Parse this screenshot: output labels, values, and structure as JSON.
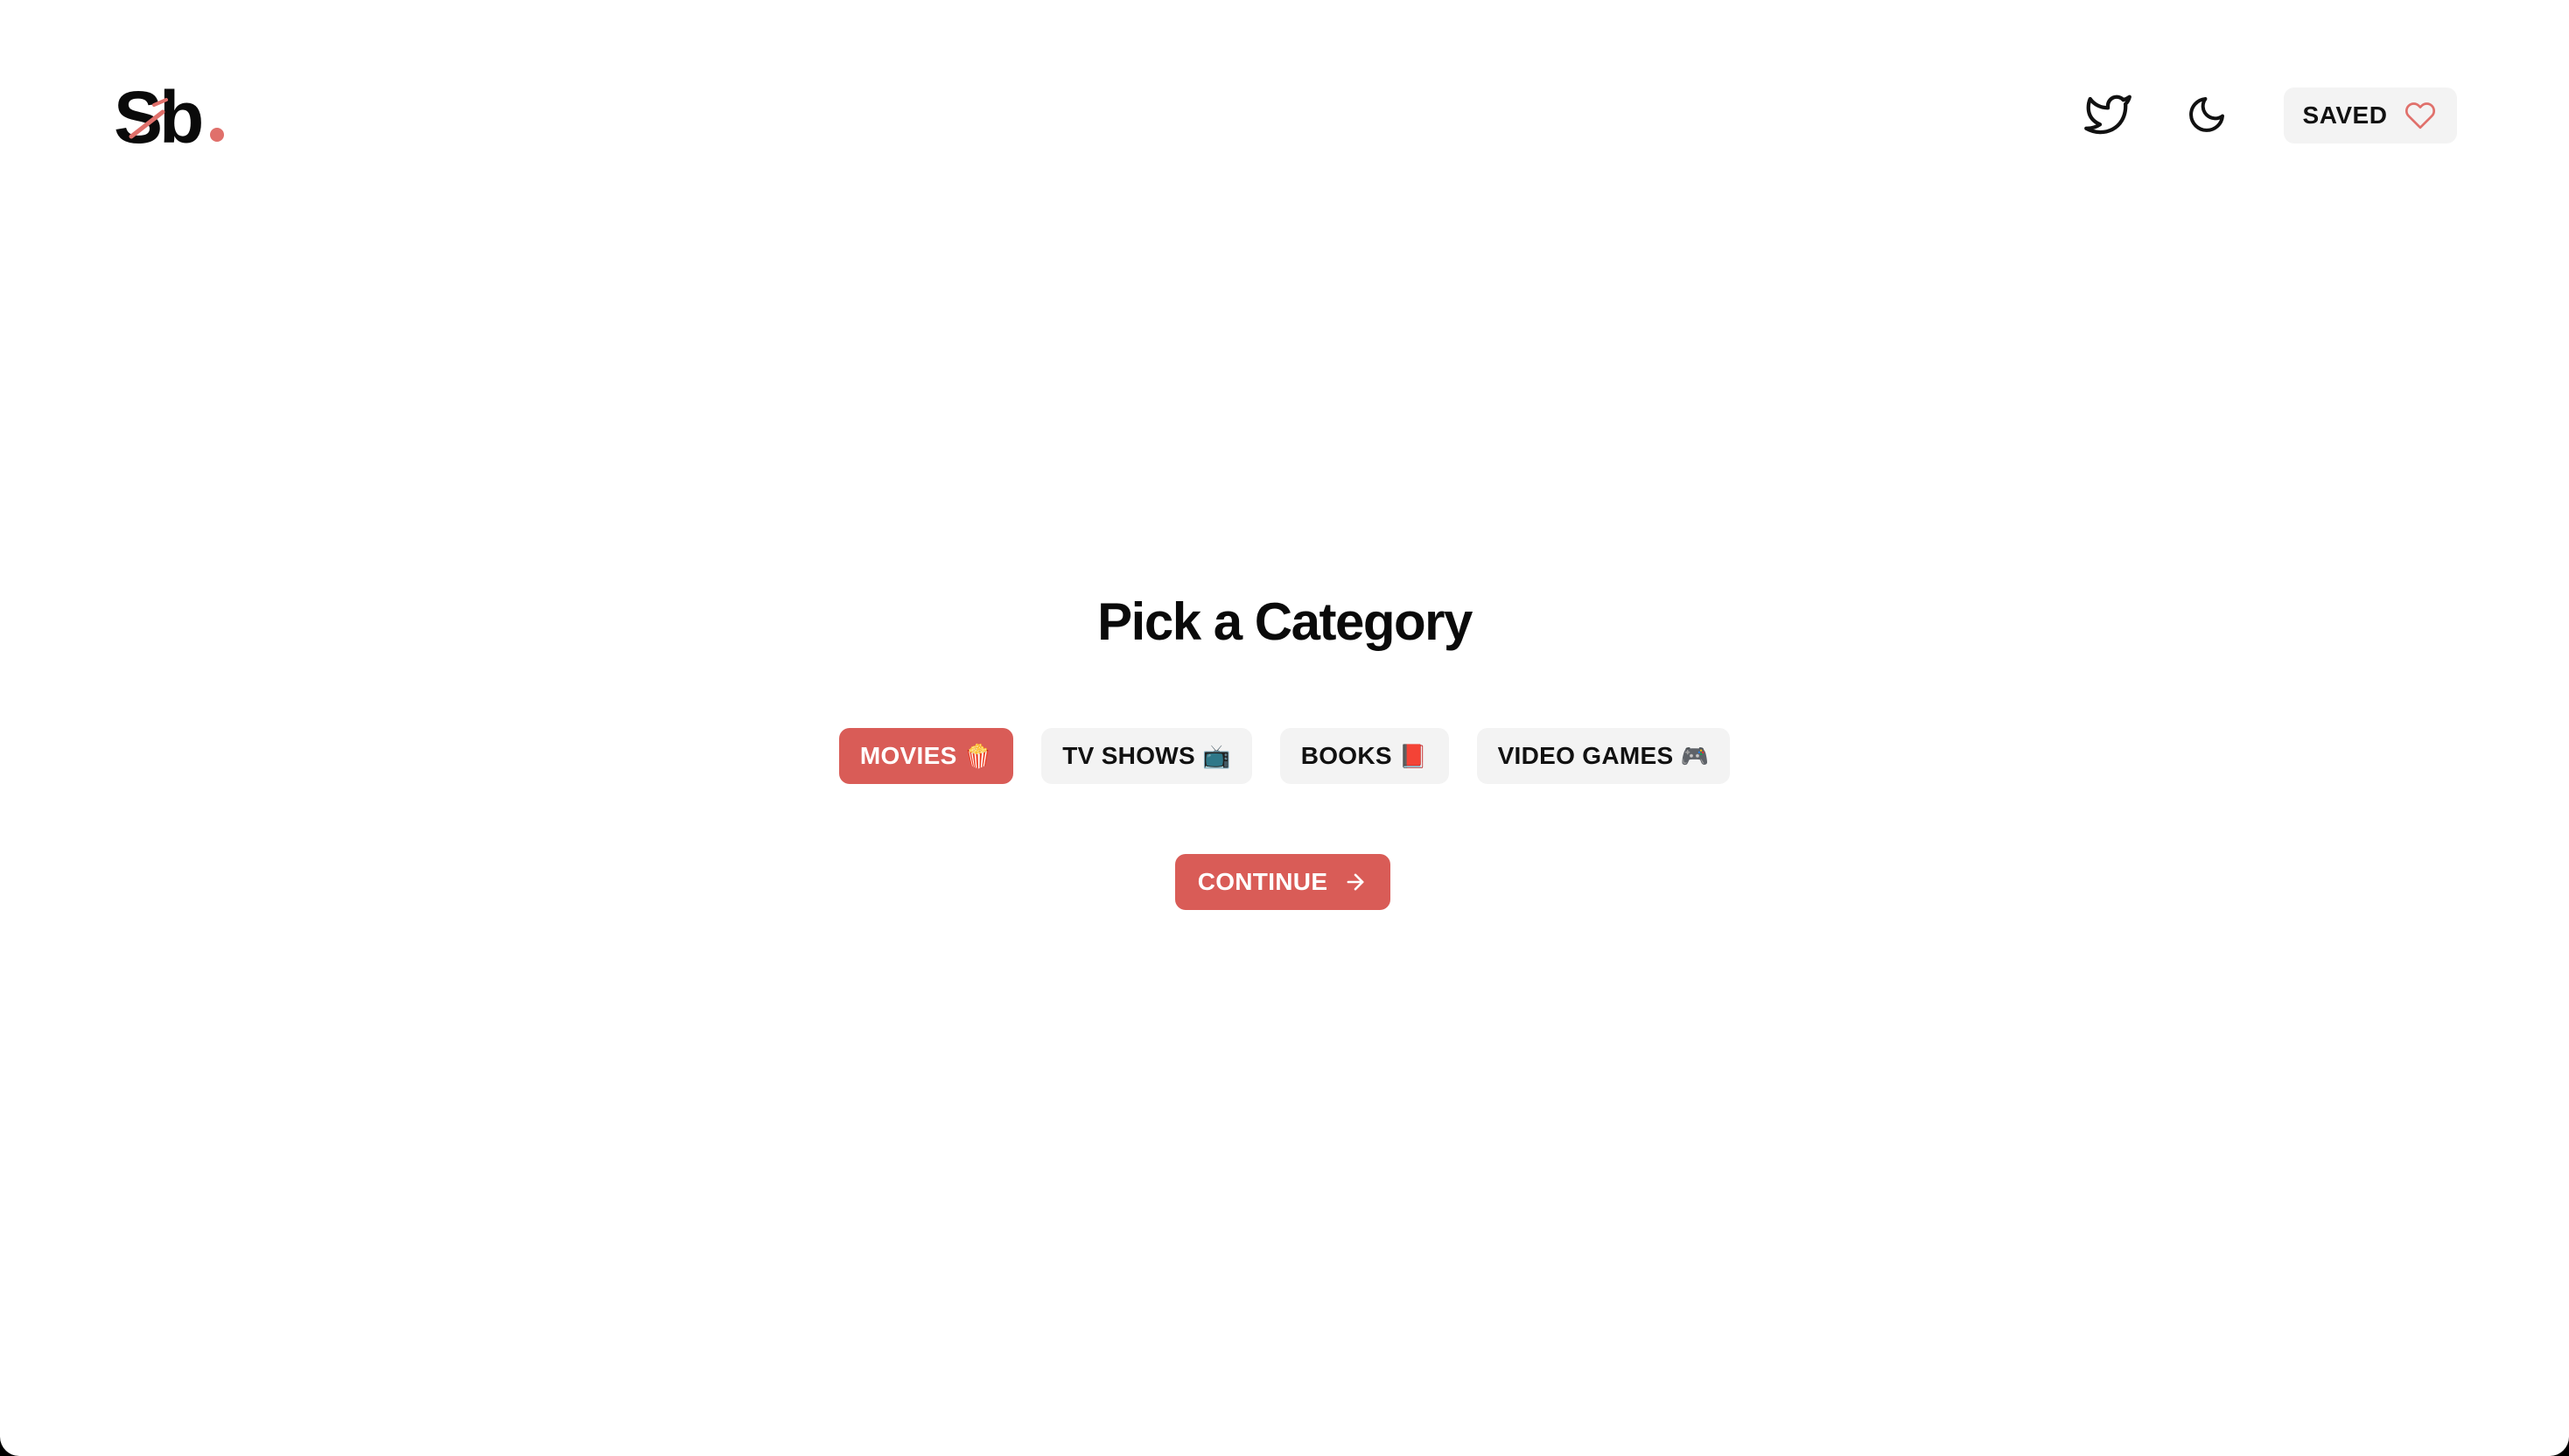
{
  "header": {
    "logo_text": "Sb",
    "twitter_icon": "twitter-icon",
    "theme_icon": "moon-icon",
    "saved_label": "SAVED",
    "saved_icon": "heart-icon"
  },
  "main": {
    "title": "Pick a Category",
    "categories": [
      {
        "label": "MOVIES",
        "emoji": "🍿",
        "selected": true
      },
      {
        "label": "TV SHOWS",
        "emoji": "📺",
        "selected": false
      },
      {
        "label": "BOOKS",
        "emoji": "📕",
        "selected": false
      },
      {
        "label": "VIDEO GAMES",
        "emoji": "🎮",
        "selected": false
      }
    ],
    "continue_label": "CONTINUE",
    "continue_icon": "arrow-right-icon"
  },
  "colors": {
    "accent": "#d95c57",
    "chip_bg": "#f3f3f3",
    "text": "#0d0d0d"
  }
}
